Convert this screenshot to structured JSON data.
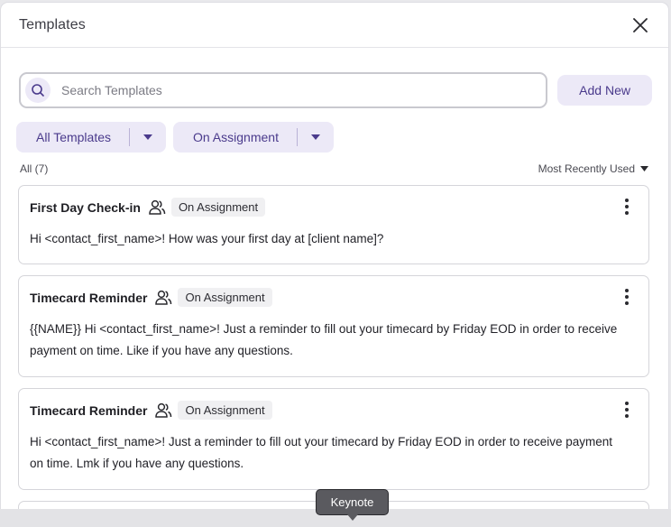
{
  "modal": {
    "title": "Templates"
  },
  "search": {
    "placeholder": "Search Templates",
    "value": ""
  },
  "toolbar": {
    "add_label": "Add New"
  },
  "filters": [
    {
      "label": "All Templates"
    },
    {
      "label": "On Assignment"
    }
  ],
  "list": {
    "count_label": "All (7)",
    "sort_label": "Most Recently Used"
  },
  "templates": [
    {
      "title": "First Day Check-in",
      "badge": "On Assignment",
      "body": "Hi <contact_first_name>! How was your first day at [client name]?"
    },
    {
      "title": "Timecard Reminder",
      "badge": "On Assignment",
      "body": "{{NAME}} Hi <contact_first_name>! Just a reminder to fill out your timecard by Friday EOD in order to receive payment on time. Like if you have any questions."
    },
    {
      "title": "Timecard Reminder",
      "badge": "On Assignment",
      "body": "Hi <contact_first_name>! Just a reminder to fill out your timecard by Friday EOD in order to receive payment on time. Lmk if you have any questions."
    }
  ],
  "tooltip": {
    "label": "Keynote"
  },
  "colors": {
    "accent_bg": "#ece9f7",
    "accent_text": "#4a3a8c",
    "badge_bg": "#f0f0f2",
    "card_border": "#d5d5da"
  },
  "icons": {
    "close": "close-icon",
    "search": "search-icon",
    "filter_caret": "caret-down-icon",
    "sort": "sort-caret-icon",
    "shared": "people-icon",
    "menu": "kebab-menu-icon"
  }
}
